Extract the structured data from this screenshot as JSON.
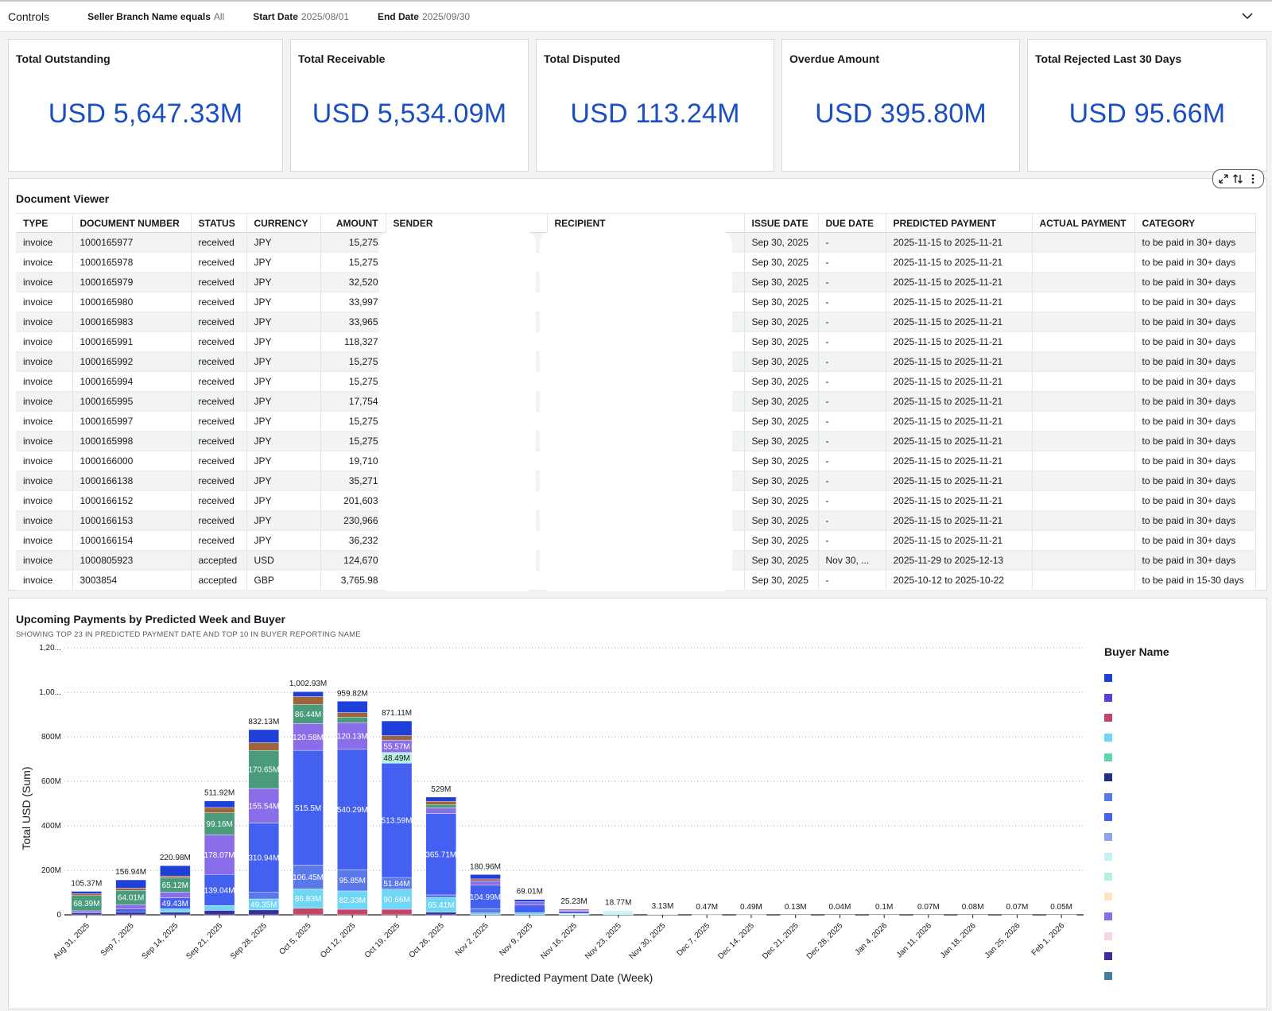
{
  "controls": {
    "title": "Controls",
    "filters": [
      {
        "label": "Seller Branch Name equals",
        "value": "All"
      },
      {
        "label": "Start Date",
        "value": "2025/08/01"
      },
      {
        "label": "End Date",
        "value": "2025/09/30"
      }
    ]
  },
  "kpis": [
    {
      "title": "Total Outstanding",
      "value": "USD 5,647.33M"
    },
    {
      "title": "Total Receivable",
      "value": "USD 5,534.09M"
    },
    {
      "title": "Total Disputed",
      "value": "USD 113.24M"
    },
    {
      "title": "Overdue Amount",
      "value": "USD 395.80M"
    },
    {
      "title": "Total Rejected Last 30 Days",
      "value": "USD 95.66M"
    }
  ],
  "document_viewer": {
    "title": "Document Viewer",
    "columns": [
      "TYPE",
      "DOCUMENT NUMBER",
      "STATUS",
      "CURRENCY",
      "AMOUNT",
      "SENDER",
      "RECIPIENT",
      "ISSUE DATE",
      "DUE DATE",
      "PREDICTED PAYMENT",
      "ACTUAL PAYMENT",
      "CATEGORY"
    ],
    "rows": [
      [
        "invoice",
        "1000165977",
        "received",
        "JPY",
        "15,275",
        "",
        "",
        "Sep 30, 2025",
        "-",
        "2025-11-15 to 2025-11-21",
        "",
        "to be paid in 30+ days"
      ],
      [
        "invoice",
        "1000165978",
        "received",
        "JPY",
        "15,275",
        "",
        "",
        "Sep 30, 2025",
        "-",
        "2025-11-15 to 2025-11-21",
        "",
        "to be paid in 30+ days"
      ],
      [
        "invoice",
        "1000165979",
        "received",
        "JPY",
        "32,520",
        "",
        "",
        "Sep 30, 2025",
        "-",
        "2025-11-15 to 2025-11-21",
        "",
        "to be paid in 30+ days"
      ],
      [
        "invoice",
        "1000165980",
        "received",
        "JPY",
        "33,997",
        "",
        "",
        "Sep 30, 2025",
        "-",
        "2025-11-15 to 2025-11-21",
        "",
        "to be paid in 30+ days"
      ],
      [
        "invoice",
        "1000165983",
        "received",
        "JPY",
        "33,965",
        "",
        "",
        "Sep 30, 2025",
        "-",
        "2025-11-15 to 2025-11-21",
        "",
        "to be paid in 30+ days"
      ],
      [
        "invoice",
        "1000165991",
        "received",
        "JPY",
        "118,327",
        "",
        "",
        "Sep 30, 2025",
        "-",
        "2025-11-15 to 2025-11-21",
        "",
        "to be paid in 30+ days"
      ],
      [
        "invoice",
        "1000165992",
        "received",
        "JPY",
        "15,275",
        "",
        "",
        "Sep 30, 2025",
        "-",
        "2025-11-15 to 2025-11-21",
        "",
        "to be paid in 30+ days"
      ],
      [
        "invoice",
        "1000165994",
        "received",
        "JPY",
        "15,275",
        "",
        "",
        "Sep 30, 2025",
        "-",
        "2025-11-15 to 2025-11-21",
        "",
        "to be paid in 30+ days"
      ],
      [
        "invoice",
        "1000165995",
        "received",
        "JPY",
        "17,754",
        "",
        "",
        "Sep 30, 2025",
        "-",
        "2025-11-15 to 2025-11-21",
        "",
        "to be paid in 30+ days"
      ],
      [
        "invoice",
        "1000165997",
        "received",
        "JPY",
        "15,275",
        "",
        "",
        "Sep 30, 2025",
        "-",
        "2025-11-15 to 2025-11-21",
        "",
        "to be paid in 30+ days"
      ],
      [
        "invoice",
        "1000165998",
        "received",
        "JPY",
        "15,275",
        "",
        "",
        "Sep 30, 2025",
        "-",
        "2025-11-15 to 2025-11-21",
        "",
        "to be paid in 30+ days"
      ],
      [
        "invoice",
        "1000166000",
        "received",
        "JPY",
        "19,710",
        "",
        "",
        "Sep 30, 2025",
        "-",
        "2025-11-15 to 2025-11-21",
        "",
        "to be paid in 30+ days"
      ],
      [
        "invoice",
        "1000166138",
        "received",
        "JPY",
        "35,271",
        "",
        "",
        "Sep 30, 2025",
        "-",
        "2025-11-15 to 2025-11-21",
        "",
        "to be paid in 30+ days"
      ],
      [
        "invoice",
        "1000166152",
        "received",
        "JPY",
        "201,603",
        "",
        "",
        "Sep 30, 2025",
        "-",
        "2025-11-15 to 2025-11-21",
        "",
        "to be paid in 30+ days"
      ],
      [
        "invoice",
        "1000166153",
        "received",
        "JPY",
        "230,966",
        "",
        "",
        "Sep 30, 2025",
        "-",
        "2025-11-15 to 2025-11-21",
        "",
        "to be paid in 30+ days"
      ],
      [
        "invoice",
        "1000166154",
        "received",
        "JPY",
        "36,232",
        "",
        "",
        "Sep 30, 2025",
        "-",
        "2025-11-15 to 2025-11-21",
        "",
        "to be paid in 30+ days"
      ],
      [
        "invoice",
        "1000805923",
        "accepted",
        "USD",
        "124,670",
        "",
        "",
        "Sep 30, 2025",
        "Nov 30, ...",
        "2025-11-29 to 2025-12-13",
        "",
        "to be paid in 30+ days"
      ],
      [
        "invoice",
        "3003854",
        "accepted",
        "GBP",
        "3,765.98",
        "",
        "",
        "Sep 30, 2025",
        "-",
        "2025-10-12 to 2025-10-22",
        "",
        "to be paid in 15-30 days"
      ]
    ]
  },
  "chart_panel": {
    "title": "Upcoming Payments by Predicted Week and Buyer",
    "subtitle": "SHOWING TOP 23 IN PREDICTED PAYMENT DATE AND TOP 10 IN BUYER REPORTING NAME",
    "legend_title": "Buyer Name",
    "legend_colors": [
      "#1f3fd9",
      "#5a3fe0",
      "#c4456a",
      "#6fd6f5",
      "#5fd3b0",
      "#1c2f8a",
      "#5b78ea",
      "#4460f0",
      "#8fa3f3",
      "#c6f1f7",
      "#b6f0df",
      "#fce3c2",
      "#8a6de8",
      "#f2d6e0",
      "#3a2f9e",
      "#3f7fa3"
    ]
  },
  "chart_data": {
    "type": "bar",
    "stacked": true,
    "xlabel": "Predicted Payment Date (Week)",
    "ylabel": "Total USD (Sum)",
    "ylim": [
      0,
      1200
    ],
    "y_unit": "M",
    "yticks": [
      "0",
      "200M",
      "400M",
      "600M",
      "800M",
      "1,00...",
      "1,20..."
    ],
    "categories": [
      "Aug 31, 2025",
      "Sep 7, 2025",
      "Sep 14, 2025",
      "Sep 21, 2025",
      "Sep 28, 2025",
      "Oct 5, 2025",
      "Oct 12, 2025",
      "Oct 19, 2025",
      "Oct 26, 2025",
      "Nov 2, 2025",
      "Nov 9, 2025",
      "Nov 16, 2025",
      "Nov 23, 2025",
      "Nov 30, 2025",
      "Dec 7, 2025",
      "Dec 14, 2025",
      "Dec 21, 2025",
      "Dec 28, 2025",
      "Jan 4, 2026",
      "Jan 11, 2026",
      "Jan 18, 2026",
      "Jan 25, 2026",
      "Feb 1, 2026"
    ],
    "totals": [
      105.37,
      156.94,
      220.98,
      511.92,
      832.13,
      1002.93,
      959.82,
      871.11,
      529,
      180.96,
      69.01,
      25.23,
      18.77,
      3.13,
      0.47,
      0.49,
      0.13,
      0.04,
      0.1,
      0.07,
      0.08,
      0.07,
      0.05
    ],
    "total_labels": [
      "105.37M",
      "156.94M",
      "220.98M",
      "511.92M",
      "832.13M",
      "1,002.93M",
      "959.82M",
      "871.11M",
      "529M",
      "180.96M",
      "69.01M",
      "25.23M",
      "18.77M",
      "3.13M",
      "0.47M",
      "0.49M",
      "0.13M",
      "0.04M",
      "0.1M",
      "0.07M",
      "0.08M",
      "0.07M",
      "0.05M"
    ],
    "segments": [
      [
        {
          "v": 8,
          "c": "#3a2f9e"
        },
        {
          "v": 10,
          "c": "#8a6de8"
        },
        {
          "v": 68.39,
          "c": "#4a9a7c",
          "label": "68.39M"
        },
        {
          "v": 9,
          "c": "#a0643c"
        },
        {
          "v": 9.98,
          "c": "#1f3fd9"
        }
      ],
      [
        {
          "v": 12,
          "c": "#3a2f9e"
        },
        {
          "v": 14,
          "c": "#4460f0"
        },
        {
          "v": 20,
          "c": "#8a6de8"
        },
        {
          "v": 64.01,
          "c": "#4a9a7c",
          "label": "64.01M"
        },
        {
          "v": 10,
          "c": "#a0643c"
        },
        {
          "v": 36.93,
          "c": "#1f3fd9"
        }
      ],
      [
        {
          "v": 12,
          "c": "#3a2f9e"
        },
        {
          "v": 15,
          "c": "#6fd6f5"
        },
        {
          "v": 49.43,
          "c": "#4460f0",
          "label": "49.43M"
        },
        {
          "v": 25,
          "c": "#8a6de8"
        },
        {
          "v": 65.12,
          "c": "#4a9a7c",
          "label": "65.12M"
        },
        {
          "v": 8,
          "c": "#a0643c"
        },
        {
          "v": 46.43,
          "c": "#1f3fd9"
        }
      ],
      [
        {
          "v": 20,
          "c": "#3a2f9e"
        },
        {
          "v": 22,
          "c": "#6fd6f5"
        },
        {
          "v": 139.04,
          "c": "#4460f0",
          "label": "139.04M"
        },
        {
          "v": 178.07,
          "c": "#8a6de8",
          "label": "178.07M"
        },
        {
          "v": 99.16,
          "c": "#4a9a7c",
          "label": "99.16M"
        },
        {
          "v": 24,
          "c": "#a0643c"
        },
        {
          "v": 29.65,
          "c": "#1f3fd9"
        }
      ],
      [
        {
          "v": 22,
          "c": "#3a2f9e"
        },
        {
          "v": 49.35,
          "c": "#6fd6f5",
          "label": "49.35M"
        },
        {
          "v": 30,
          "c": "#5b78ea"
        },
        {
          "v": 310.94,
          "c": "#4460f0",
          "label": "310.94M"
        },
        {
          "v": 155.54,
          "c": "#8a6de8",
          "label": "155.54M"
        },
        {
          "v": 170.65,
          "c": "#4a9a7c",
          "label": "170.65M"
        },
        {
          "v": 35,
          "c": "#a0643c"
        },
        {
          "v": 58.65,
          "c": "#1f3fd9"
        }
      ],
      [
        {
          "v": 30,
          "c": "#c4456a"
        },
        {
          "v": 86.83,
          "c": "#6fd6f5",
          "label": "86.83M"
        },
        {
          "v": 106.45,
          "c": "#5b78ea",
          "label": "106.45M"
        },
        {
          "v": 515.5,
          "c": "#4460f0",
          "label": "515.5M"
        },
        {
          "v": 120.58,
          "c": "#8a6de8",
          "label": "120.58M"
        },
        {
          "v": 86.44,
          "c": "#4a9a7c",
          "label": "86.44M"
        },
        {
          "v": 35,
          "c": "#a0643c"
        },
        {
          "v": 22.13,
          "c": "#1f3fd9"
        }
      ],
      [
        {
          "v": 25,
          "c": "#c4456a"
        },
        {
          "v": 82.33,
          "c": "#6fd6f5",
          "label": "82.33M"
        },
        {
          "v": 95.85,
          "c": "#5b78ea",
          "label": "95.85M"
        },
        {
          "v": 540.29,
          "c": "#4460f0",
          "label": "540.29M"
        },
        {
          "v": 120.13,
          "c": "#8a6de8",
          "label": "120.13M"
        },
        {
          "v": 25,
          "c": "#4a9a7c"
        },
        {
          "v": 20,
          "c": "#a0643c"
        },
        {
          "v": 51.22,
          "c": "#1f3fd9"
        }
      ],
      [
        {
          "v": 25,
          "c": "#c4456a"
        },
        {
          "v": 90.66,
          "c": "#6fd6f5",
          "label": "90.66M"
        },
        {
          "v": 51.84,
          "c": "#5b78ea",
          "label": "51.84M"
        },
        {
          "v": 513.59,
          "c": "#4460f0",
          "label": "513.59M"
        },
        {
          "v": 48.49,
          "c": "#b6f0df",
          "label": "48.49M"
        },
        {
          "v": 55.57,
          "c": "#8a6de8",
          "label": "55.57M"
        },
        {
          "v": 20,
          "c": "#a0643c"
        },
        {
          "v": 65.96,
          "c": "#1f3fd9"
        }
      ],
      [
        {
          "v": 12,
          "c": "#3a2f9e"
        },
        {
          "v": 65.41,
          "c": "#6fd6f5",
          "label": "65.41M"
        },
        {
          "v": 12,
          "c": "#5b78ea"
        },
        {
          "v": 365.71,
          "c": "#4460f0",
          "label": "365.71M"
        },
        {
          "v": 25,
          "c": "#8a6de8"
        },
        {
          "v": 15,
          "c": "#4a9a7c"
        },
        {
          "v": 15,
          "c": "#a0643c"
        },
        {
          "v": 18.88,
          "c": "#1f3fd9"
        }
      ],
      [
        {
          "v": 8,
          "c": "#6fd6f5"
        },
        {
          "v": 20,
          "c": "#5b78ea"
        },
        {
          "v": 104.99,
          "c": "#4460f0",
          "label": "104.99M"
        },
        {
          "v": 20,
          "c": "#8a6de8"
        },
        {
          "v": 8,
          "c": "#a0643c"
        },
        {
          "v": 19.97,
          "c": "#1f3fd9"
        }
      ],
      [
        {
          "v": 10,
          "c": "#6fd6f5"
        },
        {
          "v": 35,
          "c": "#4460f0"
        },
        {
          "v": 14,
          "c": "#8a6de8"
        },
        {
          "v": 10.01,
          "c": "#1f3fd9"
        }
      ],
      [
        {
          "v": 6,
          "c": "#c6f1f7"
        },
        {
          "v": 10,
          "c": "#4460f0"
        },
        {
          "v": 5,
          "c": "#8a6de8"
        },
        {
          "v": 4.23,
          "c": "#c4456a"
        }
      ],
      [
        {
          "v": 12,
          "c": "#c6f1f7"
        },
        {
          "v": 6.77,
          "c": "#c6f1f7"
        }
      ],
      [
        {
          "v": 3.13,
          "c": "#c6f1f7"
        }
      ],
      [
        {
          "v": 0.47,
          "c": "#c6f1f7"
        }
      ],
      [
        {
          "v": 0.49,
          "c": "#c6f1f7"
        }
      ],
      [
        {
          "v": 0.13,
          "c": "#c6f1f7"
        }
      ],
      [
        {
          "v": 0.04,
          "c": "#c6f1f7"
        }
      ],
      [
        {
          "v": 0.1,
          "c": "#c6f1f7"
        }
      ],
      [
        {
          "v": 0.07,
          "c": "#c6f1f7"
        }
      ],
      [
        {
          "v": 0.08,
          "c": "#c6f1f7"
        }
      ],
      [
        {
          "v": 0.07,
          "c": "#c6f1f7"
        }
      ],
      [
        {
          "v": 0.05,
          "c": "#c6f1f7"
        }
      ]
    ]
  }
}
